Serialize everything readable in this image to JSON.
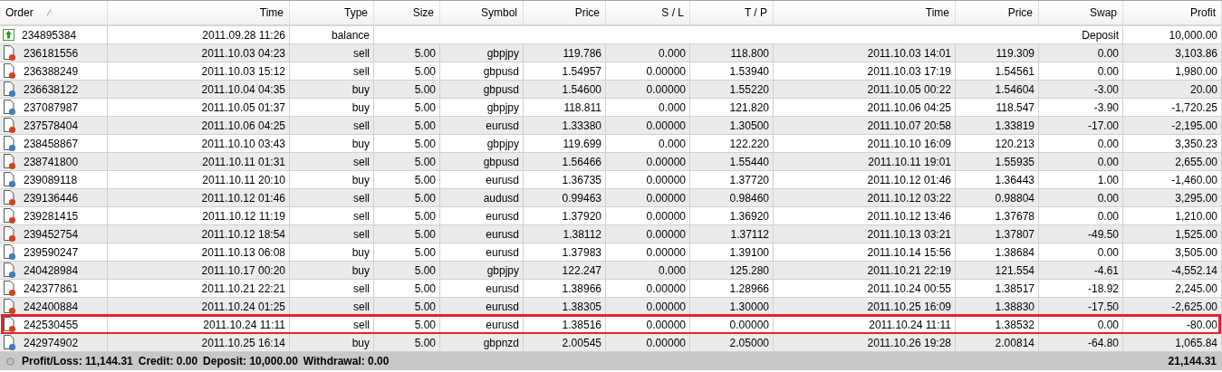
{
  "columns": [
    {
      "label": "Order",
      "sorted": true
    },
    {
      "label": "Time",
      "sorted": false
    },
    {
      "label": "Type",
      "sorted": false
    },
    {
      "label": "Size",
      "sorted": false
    },
    {
      "label": "Symbol",
      "sorted": false
    },
    {
      "label": "Price",
      "sorted": false
    },
    {
      "label": "S / L",
      "sorted": false
    },
    {
      "label": "T / P",
      "sorted": false
    },
    {
      "label": "Time",
      "sorted": false
    },
    {
      "label": "Price",
      "sorted": false
    },
    {
      "label": "Swap",
      "sorted": false
    },
    {
      "label": "Profit",
      "sorted": false
    }
  ],
  "rows": [
    {
      "kind": "balance",
      "highlighted": false,
      "cells": [
        "234895384",
        "2011.09.28 11:26",
        "balance"
      ],
      "comment": "Deposit",
      "profit": "10,000.00"
    },
    {
      "kind": "sell",
      "highlighted": false,
      "cells": [
        "236181556",
        "2011.10.03 04:23",
        "sell",
        "5.00",
        "gbpjpy",
        "119.786",
        "0.000",
        "118.800",
        "2011.10.03 14:01",
        "119.309",
        "0.00",
        "3,103.86"
      ]
    },
    {
      "kind": "sell",
      "highlighted": false,
      "cells": [
        "236388249",
        "2011.10.03 15:12",
        "sell",
        "5.00",
        "gbpusd",
        "1.54957",
        "0.00000",
        "1.53940",
        "2011.10.03 17:19",
        "1.54561",
        "0.00",
        "1,980.00"
      ]
    },
    {
      "kind": "buy",
      "highlighted": false,
      "cells": [
        "236638122",
        "2011.10.04 04:35",
        "buy",
        "5.00",
        "gbpusd",
        "1.54600",
        "0.00000",
        "1.55220",
        "2011.10.05 00:22",
        "1.54604",
        "-3.00",
        "20.00"
      ]
    },
    {
      "kind": "buy",
      "highlighted": false,
      "cells": [
        "237087987",
        "2011.10.05 01:37",
        "buy",
        "5.00",
        "gbpjpy",
        "118.811",
        "0.000",
        "121.820",
        "2011.10.06 04:25",
        "118.547",
        "-3.90",
        "-1,720.25"
      ]
    },
    {
      "kind": "sell",
      "highlighted": false,
      "cells": [
        "237578404",
        "2011.10.06 04:25",
        "sell",
        "5.00",
        "eurusd",
        "1.33380",
        "0.00000",
        "1.30500",
        "2011.10.07 20:58",
        "1.33819",
        "-17.00",
        "-2,195.00"
      ]
    },
    {
      "kind": "buy",
      "highlighted": false,
      "cells": [
        "238458867",
        "2011.10.10 03:43",
        "buy",
        "5.00",
        "gbpjpy",
        "119.699",
        "0.000",
        "122.220",
        "2011.10.10 16:09",
        "120.213",
        "0.00",
        "3,350.23"
      ]
    },
    {
      "kind": "sell",
      "highlighted": false,
      "cells": [
        "238741800",
        "2011.10.11 01:31",
        "sell",
        "5.00",
        "gbpusd",
        "1.56466",
        "0.00000",
        "1.55440",
        "2011.10.11 19:01",
        "1.55935",
        "0.00",
        "2,655.00"
      ]
    },
    {
      "kind": "buy",
      "highlighted": false,
      "cells": [
        "239089118",
        "2011.10.11 20:10",
        "buy",
        "5.00",
        "eurusd",
        "1.36735",
        "0.00000",
        "1.37720",
        "2011.10.12 01:46",
        "1.36443",
        "1.00",
        "-1,460.00"
      ]
    },
    {
      "kind": "sell",
      "highlighted": false,
      "cells": [
        "239136446",
        "2011.10.12 01:46",
        "sell",
        "5.00",
        "audusd",
        "0.99463",
        "0.00000",
        "0.98460",
        "2011.10.12 03:22",
        "0.98804",
        "0.00",
        "3,295.00"
      ]
    },
    {
      "kind": "sell",
      "highlighted": false,
      "cells": [
        "239281415",
        "2011.10.12 11:19",
        "sell",
        "5.00",
        "eurusd",
        "1.37920",
        "0.00000",
        "1.36920",
        "2011.10.12 13:46",
        "1.37678",
        "0.00",
        "1,210.00"
      ]
    },
    {
      "kind": "sell",
      "highlighted": false,
      "cells": [
        "239452754",
        "2011.10.12 18:54",
        "sell",
        "5.00",
        "eurusd",
        "1.38112",
        "0.00000",
        "1.37112",
        "2011.10.13 03:21",
        "1.37807",
        "-49.50",
        "1,525.00"
      ]
    },
    {
      "kind": "buy",
      "highlighted": false,
      "cells": [
        "239590247",
        "2011.10.13 06:08",
        "buy",
        "5.00",
        "eurusd",
        "1.37983",
        "0.00000",
        "1.39100",
        "2011.10.14 15:56",
        "1.38684",
        "0.00",
        "3,505.00"
      ]
    },
    {
      "kind": "buy",
      "highlighted": false,
      "cells": [
        "240428984",
        "2011.10.17 00:20",
        "buy",
        "5.00",
        "gbpjpy",
        "122.247",
        "0.000",
        "125.280",
        "2011.10.21 22:19",
        "121.554",
        "-4.61",
        "-4,552.14"
      ]
    },
    {
      "kind": "sell",
      "highlighted": false,
      "cells": [
        "242377861",
        "2011.10.21 22:21",
        "sell",
        "5.00",
        "eurusd",
        "1.38966",
        "0.00000",
        "1.28966",
        "2011.10.24 00:55",
        "1.38517",
        "-18.92",
        "2,245.00"
      ]
    },
    {
      "kind": "sell",
      "highlighted": false,
      "cells": [
        "242400884",
        "2011.10.24 01:25",
        "sell",
        "5.00",
        "eurusd",
        "1.38305",
        "0.00000",
        "1.30000",
        "2011.10.25 16:09",
        "1.38830",
        "-17.50",
        "-2,625.00"
      ]
    },
    {
      "kind": "sell",
      "highlighted": true,
      "cells": [
        "242530455",
        "2011.10.24 11:11",
        "sell",
        "5.00",
        "eurusd",
        "1.38516",
        "0.00000",
        "0.00000",
        "2011.10.24 11:11",
        "1.38532",
        "0.00",
        "-80.00"
      ]
    },
    {
      "kind": "buy",
      "highlighted": false,
      "cells": [
        "242974902",
        "2011.10.25 16:14",
        "buy",
        "5.00",
        "gbpnzd",
        "2.00545",
        "0.00000",
        "2.05000",
        "2011.10.26 19:28",
        "2.00814",
        "-64.80",
        "1,065.84"
      ]
    }
  ],
  "summary": {
    "items": [
      "Profit/Loss: 11,144.31",
      "Credit: 0.00",
      "Deposit: 10,000.00",
      "Withdrawal: 0.00"
    ],
    "total": "21,144.31"
  }
}
